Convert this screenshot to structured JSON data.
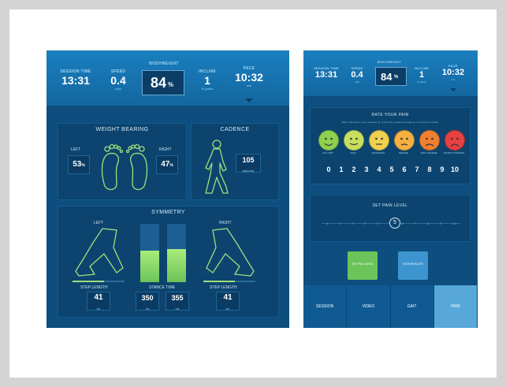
{
  "left": {
    "header": {
      "session_time": {
        "label": "SESSION TIME",
        "value": "13:31"
      },
      "speed": {
        "label": "SPEED",
        "value": "0.4",
        "unit": "mph"
      },
      "bodyweight": {
        "label": "BODYWEIGHT",
        "value": "84",
        "suffix": "%"
      },
      "incline": {
        "label": "INCLINE",
        "value": "1",
        "unit": "% grade"
      },
      "pace": {
        "label": "PACE",
        "value": "10:32",
        "unit": "min"
      }
    },
    "weight_bearing": {
      "title": "WEIGHT BEARING",
      "left_label": "LEFT",
      "left_value": "53",
      "right_label": "RIGHT",
      "right_value": "47",
      "suffix": "%"
    },
    "cadence": {
      "title": "CADENCE",
      "value": "105",
      "unit": "steps/min"
    },
    "symmetry": {
      "title": "SYMMETRY",
      "left_label": "LEFT",
      "right_label": "RIGHT",
      "step_length_label": "STEP LENGTH",
      "stance_time_label": "STANCE TIME",
      "left_step": "41",
      "right_step": "41",
      "step_unit": "cm",
      "stance_left": "350",
      "stance_right": "355",
      "stance_unit": "ms",
      "left_bar_fill": 0.35,
      "right_bar_fill": 0.4
    }
  },
  "right": {
    "header": {
      "session_time": {
        "label": "SESSION TIME",
        "value": "13:31"
      },
      "speed": {
        "label": "SPEED",
        "value": "0.4",
        "unit": "mph"
      },
      "bodyweight": {
        "label": "BODYWEIGHT",
        "value": "84",
        "suffix": "%"
      },
      "incline": {
        "label": "INCLINE",
        "value": "1",
        "unit": "% grade"
      },
      "pace": {
        "label": "PACE",
        "value": "10:32",
        "unit": "min"
      }
    },
    "rate_pain": {
      "title": "RATE YOUR PAIN",
      "subtitle": "Rate the pain your patient is currently experiencing on a 10-point scale",
      "faces": [
        {
          "label": "NO HURT",
          "color": "#8fd14f"
        },
        {
          "label": "MILD",
          "color": "#c8e060"
        },
        {
          "label": "MODERATE",
          "color": "#f0d050"
        },
        {
          "label": "SEVERE",
          "color": "#f5b040"
        },
        {
          "label": "VERY SEVERE",
          "color": "#f08030"
        },
        {
          "label": "WORST POSSIBLE",
          "color": "#e84040"
        }
      ],
      "numbers": [
        "0",
        "1",
        "2",
        "3",
        "4",
        "5",
        "6",
        "7",
        "8",
        "9",
        "10"
      ]
    },
    "set_pain": {
      "title": "SET PAIN LEVEL",
      "levels": [
        "0",
        "1",
        "2",
        "3",
        "4",
        "5",
        "6",
        "7",
        "8",
        "9",
        "10"
      ],
      "selected": "5"
    },
    "buttons": {
      "set_pain": "SET PAIN LEVEL",
      "view_results": "VIEW RESULTS"
    },
    "tabs": [
      "SESSION",
      "VIDEO",
      "GAIT",
      "PAIN"
    ]
  }
}
